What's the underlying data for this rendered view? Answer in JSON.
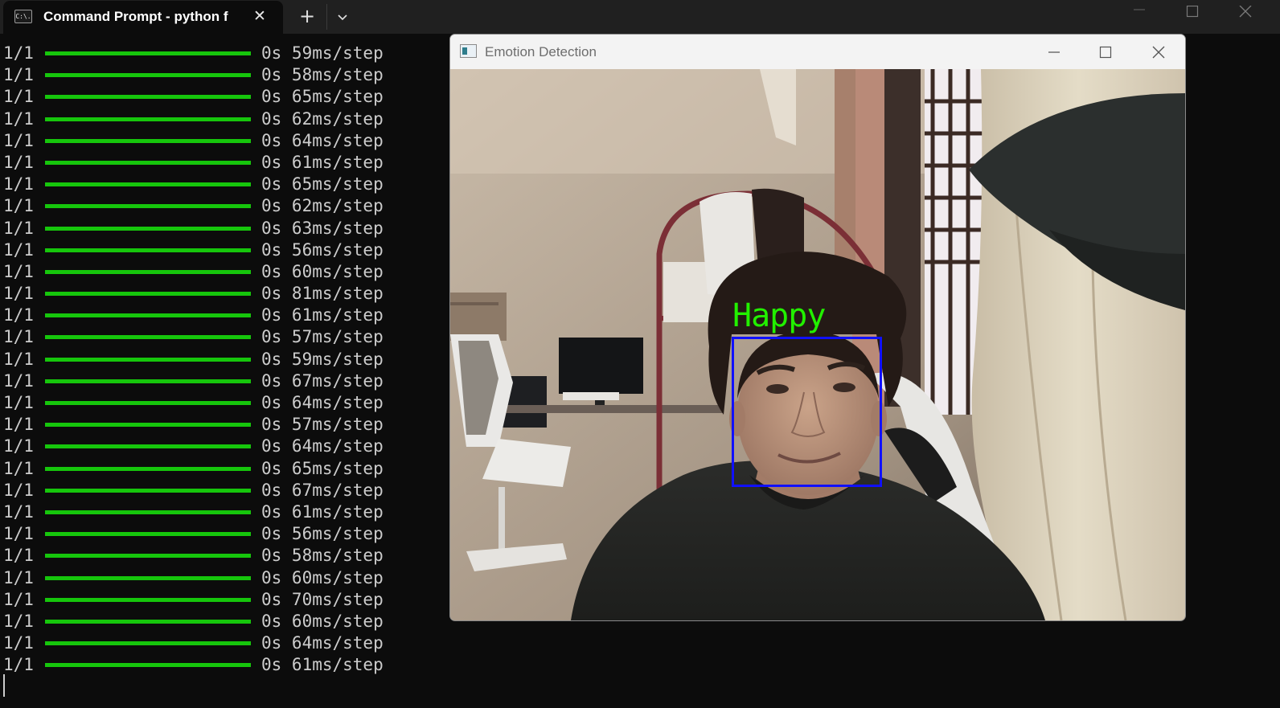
{
  "terminal": {
    "tab_title": "Command Prompt - python  f",
    "tab_icon_text": "C:\\.",
    "icons": {
      "tab": "cmd-icon",
      "close_tab": "close-icon",
      "new_tab": "plus-icon",
      "dropdown": "chevron-down-icon",
      "minimize": "minimize-icon",
      "maximize": "maximize-icon",
      "close_window": "close-icon"
    },
    "progress_color": "#16c60c",
    "lines": [
      {
        "count": "1/1",
        "progress": 1.0,
        "time": "0s 59ms/step"
      },
      {
        "count": "1/1",
        "progress": 1.0,
        "time": "0s 58ms/step"
      },
      {
        "count": "1/1",
        "progress": 1.0,
        "time": "0s 65ms/step"
      },
      {
        "count": "1/1",
        "progress": 1.0,
        "time": "0s 62ms/step"
      },
      {
        "count": "1/1",
        "progress": 1.0,
        "time": "0s 64ms/step"
      },
      {
        "count": "1/1",
        "progress": 1.0,
        "time": "0s 61ms/step"
      },
      {
        "count": "1/1",
        "progress": 1.0,
        "time": "0s 65ms/step"
      },
      {
        "count": "1/1",
        "progress": 1.0,
        "time": "0s 62ms/step"
      },
      {
        "count": "1/1",
        "progress": 1.0,
        "time": "0s 63ms/step"
      },
      {
        "count": "1/1",
        "progress": 1.0,
        "time": "0s 56ms/step"
      },
      {
        "count": "1/1",
        "progress": 1.0,
        "time": "0s 60ms/step"
      },
      {
        "count": "1/1",
        "progress": 1.0,
        "time": "0s 81ms/step"
      },
      {
        "count": "1/1",
        "progress": 1.0,
        "time": "0s 61ms/step"
      },
      {
        "count": "1/1",
        "progress": 1.0,
        "time": "0s 57ms/step"
      },
      {
        "count": "1/1",
        "progress": 1.0,
        "time": "0s 59ms/step"
      },
      {
        "count": "1/1",
        "progress": 1.0,
        "time": "0s 67ms/step"
      },
      {
        "count": "1/1",
        "progress": 1.0,
        "time": "0s 64ms/step"
      },
      {
        "count": "1/1",
        "progress": 1.0,
        "time": "0s 57ms/step"
      },
      {
        "count": "1/1",
        "progress": 1.0,
        "time": "0s 64ms/step"
      },
      {
        "count": "1/1",
        "progress": 1.0,
        "time": "0s 65ms/step"
      },
      {
        "count": "1/1",
        "progress": 1.0,
        "time": "0s 67ms/step"
      },
      {
        "count": "1/1",
        "progress": 1.0,
        "time": "0s 61ms/step"
      },
      {
        "count": "1/1",
        "progress": 1.0,
        "time": "0s 56ms/step"
      },
      {
        "count": "1/1",
        "progress": 1.0,
        "time": "0s 58ms/step"
      },
      {
        "count": "1/1",
        "progress": 1.0,
        "time": "0s 60ms/step"
      },
      {
        "count": "1/1",
        "progress": 1.0,
        "time": "0s 70ms/step"
      },
      {
        "count": "1/1",
        "progress": 1.0,
        "time": "0s 60ms/step"
      },
      {
        "count": "1/1",
        "progress": 1.0,
        "time": "0s 64ms/step"
      },
      {
        "count": "1/1",
        "progress": 1.0,
        "time": "0s 61ms/step"
      }
    ]
  },
  "detection_window": {
    "title": "Emotion Detection",
    "emotion_label": "Happy",
    "label_color": "#22f000",
    "box_color": "#1010ff",
    "icons": {
      "app": "opencv-window-icon",
      "minimize": "minimize-icon",
      "maximize": "maximize-icon",
      "close": "close-icon"
    }
  }
}
